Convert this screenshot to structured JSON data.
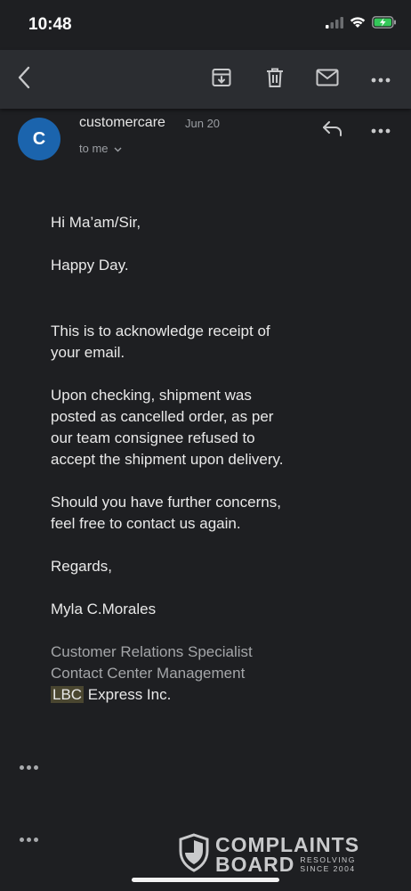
{
  "status_bar": {
    "time": "10:48",
    "icons": [
      "signal-icon",
      "wifi-icon",
      "battery-charging-icon"
    ],
    "battery_color": "#34c759"
  },
  "toolbar": {
    "icons": [
      "back-icon",
      "archive-icon",
      "delete-icon",
      "mark-unread-icon",
      "more-icon"
    ]
  },
  "email": {
    "sender_initial": "C",
    "sender_name": "customercare",
    "date": "Jun 20",
    "recipient": "to me",
    "avatar_color": "#1b64ad",
    "body": {
      "greeting": "Hi Ma’am/Sir,",
      "line2": "Happy Day.",
      "para1_l1": "This is to acknowledge receipt of",
      "para1_l2": "your email.",
      "para2_l1": "Upon checking, shipment was",
      "para2_l2": "posted as cancelled order, as per",
      "para2_l3": "our team consignee refused to",
      "para2_l4": "accept the shipment upon delivery.",
      "para3_l1": "Should you have further concerns,",
      "para3_l2": "feel free to contact us again.",
      "closing": "Regards,",
      "signer": "Myla C.Morales",
      "title1": "Customer Relations Specialist",
      "title2": "Contact Center Management",
      "company_highlight": "LBC",
      "company_rest": " Express Inc."
    }
  },
  "watermark": {
    "line1": "COMPLAINTS",
    "line2": "BOARD",
    "tag1": "RESOLVING",
    "tag2": "SINCE 2004"
  }
}
